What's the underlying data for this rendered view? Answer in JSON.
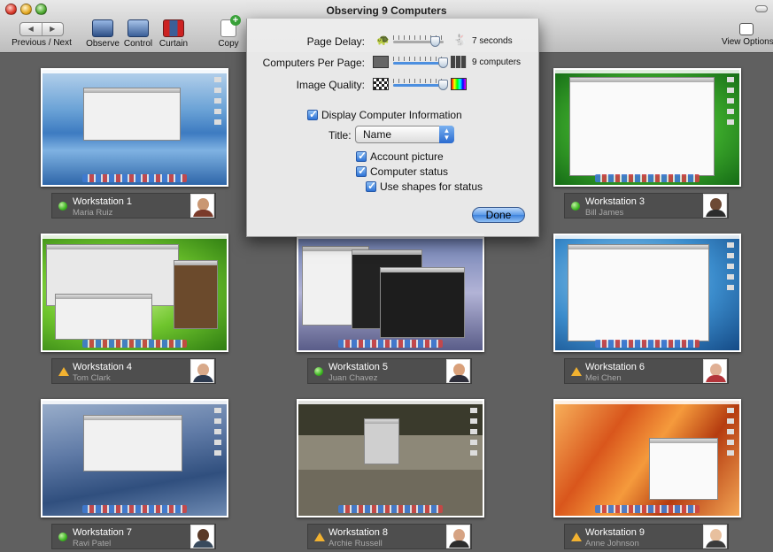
{
  "window": {
    "title": "Observing 9 Computers"
  },
  "toolbar": {
    "prev_next_label": "Previous / Next",
    "observe_label": "Observe",
    "control_label": "Control",
    "curtain_label": "Curtain",
    "copy_label": "Copy",
    "view_options_label": "View Options"
  },
  "panel": {
    "page_delay": {
      "label": "Page Delay:",
      "value": "7 seconds",
      "level": 0.85
    },
    "computers_per_page": {
      "label": "Computers Per Page:",
      "value": "9 computers",
      "level": 1.0
    },
    "image_quality": {
      "label": "Image Quality:",
      "level": 1.0
    },
    "display_info": {
      "label": "Display Computer Information",
      "checked": true
    },
    "title": {
      "label": "Title:",
      "value": "Name"
    },
    "account_picture": {
      "label": "Account picture",
      "checked": true
    },
    "computer_status": {
      "label": "Computer status",
      "checked": true
    },
    "use_shapes": {
      "label": "Use shapes for status",
      "checked": true
    },
    "done_label": "Done"
  },
  "computers": [
    {
      "name": "Workstation 1",
      "user": "Maria Ruiz",
      "status": "ok"
    },
    {
      "name": "Workstation 3",
      "user": "Bill James",
      "status": "ok"
    },
    {
      "name": "Workstation 4",
      "user": "Tom Clark",
      "status": "warn"
    },
    {
      "name": "Workstation 5",
      "user": "Juan Chavez",
      "status": "ok"
    },
    {
      "name": "Workstation 6",
      "user": "Mei Chen",
      "status": "warn"
    },
    {
      "name": "Workstation 7",
      "user": "Ravi Patel",
      "status": "ok"
    },
    {
      "name": "Workstation 8",
      "user": "Archie Russell",
      "status": "warn"
    },
    {
      "name": "Workstation 9",
      "user": "Anne Johnson",
      "status": "warn"
    }
  ],
  "colors": {
    "status_ok": "#3bb520",
    "status_warn": "#f2b230",
    "accent": "#3e82dc"
  }
}
